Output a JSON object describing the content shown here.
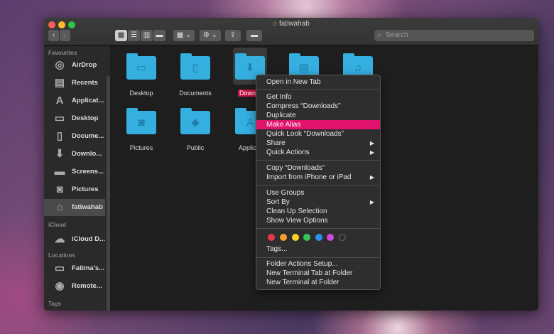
{
  "window": {
    "title": "fatiwahab",
    "search_placeholder": "Search"
  },
  "toolbar": {
    "back": "‹",
    "forward": "›",
    "view_icons": "▦",
    "view_list": "☰",
    "view_columns": "▥",
    "view_gallery": "▬",
    "group": "▦ ⌄",
    "action": "⚙ ⌄",
    "share": "⇪",
    "tag": "▬"
  },
  "sidebar": {
    "sections": [
      {
        "label": "Favourites",
        "items": [
          {
            "label": "AirDrop",
            "icon": "◎"
          },
          {
            "label": "Recents",
            "icon": "▤"
          },
          {
            "label": "Applicat...",
            "icon": "A"
          },
          {
            "label": "Desktop",
            "icon": "▭"
          },
          {
            "label": "Docume...",
            "icon": "▯"
          },
          {
            "label": "Downlo...",
            "icon": "⬇"
          },
          {
            "label": "Screens...",
            "icon": "▬"
          },
          {
            "label": "Pictures",
            "icon": "◙"
          },
          {
            "label": "fatiwahab",
            "icon": "⌂"
          }
        ]
      },
      {
        "label": "iCloud",
        "items": [
          {
            "label": "iCloud D...",
            "icon": "☁"
          }
        ]
      },
      {
        "label": "Locations",
        "items": [
          {
            "label": "Fatima's...",
            "icon": "▭"
          },
          {
            "label": "Remote...",
            "icon": "◉"
          }
        ]
      },
      {
        "label": "Tags",
        "items": []
      }
    ]
  },
  "folders": [
    {
      "label": "Desktop",
      "icon": "▭"
    },
    {
      "label": "Documents",
      "icon": "▯"
    },
    {
      "label": "Downlo",
      "icon": "⬇"
    },
    {
      "label": "",
      "icon": "▤"
    },
    {
      "label": "",
      "icon": "♫"
    },
    {
      "label": "Pictures",
      "icon": "◙"
    },
    {
      "label": "Public",
      "icon": "◆"
    },
    {
      "label": "Applicat",
      "icon": "A"
    }
  ],
  "menu": {
    "items": [
      "Open in New Tab",
      "Get Info",
      "Compress “Downloads”",
      "Duplicate",
      "Make Alias",
      "Quick Look “Downloads”",
      "Share",
      "Quick Actions",
      "Copy “Downloads”",
      "Import from iPhone or iPad",
      "Use Groups",
      "Sort By",
      "Clean Up Selection",
      "Show View Options",
      "Tags...",
      "Folder Actions Setup...",
      "New Terminal Tab at Folder",
      "New Terminal at Folder"
    ],
    "highlighted": "Make Alias",
    "submenu_arrow": "▶",
    "tag_colors": [
      "#e8364b",
      "#f5a030",
      "#f5d02a",
      "#35c759",
      "#2f8ff0",
      "#d048e0",
      "#2e2e2e"
    ]
  },
  "colors": {
    "accent": "#e0146c",
    "folder": "#35aee0"
  }
}
